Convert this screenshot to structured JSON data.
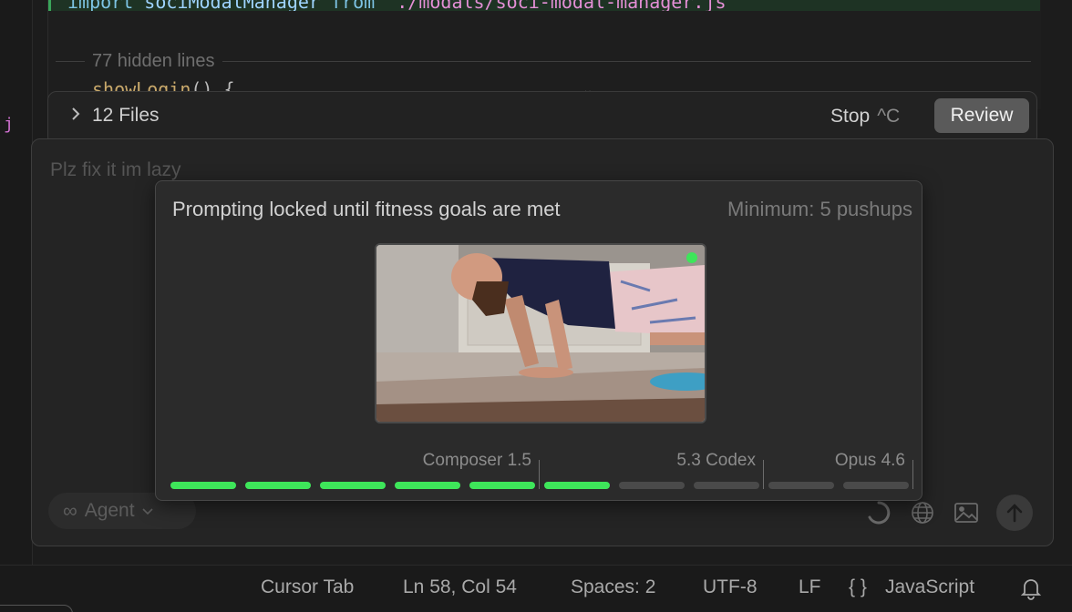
{
  "editor": {
    "import_keyword": "import",
    "import_name": "sociModalManager",
    "from_keyword": "from",
    "import_path": "'./modals/soci-modal-manager.js",
    "hidden_lines": "77 hidden lines",
    "show_login_name": "showLogin",
    "show_login_parens": "() {"
  },
  "files_bar": {
    "label": "12 Files",
    "stop_label": "Stop",
    "stop_shortcut": "^C",
    "review_label": "Review"
  },
  "composer": {
    "prompt_text": "Plz fix it im lazy",
    "agent_label": "Agent"
  },
  "modal": {
    "title": "Prompting locked until fitness goals are met",
    "minimum": "Minimum: 5 pushups",
    "models": [
      "Composer 1.5",
      "5.3 Codex",
      "Opus 4.6"
    ],
    "progress_filled": 6,
    "progress_total": 10,
    "filled_color": "#3ee65a",
    "empty_color": "#4a4a4a"
  },
  "status_bar": {
    "cursor_tab": "Cursor Tab",
    "position": "Ln 58, Col 54",
    "spaces": "Spaces: 2",
    "encoding": "UTF-8",
    "eol": "LF",
    "language": "JavaScript",
    "braces": "{ }"
  },
  "icons": [
    "chevron-right-icon",
    "infinity-icon",
    "chevron-down-icon",
    "spinner-icon",
    "globe-icon",
    "image-icon",
    "arrow-up-icon",
    "bell-icon",
    "braces-icon"
  ]
}
